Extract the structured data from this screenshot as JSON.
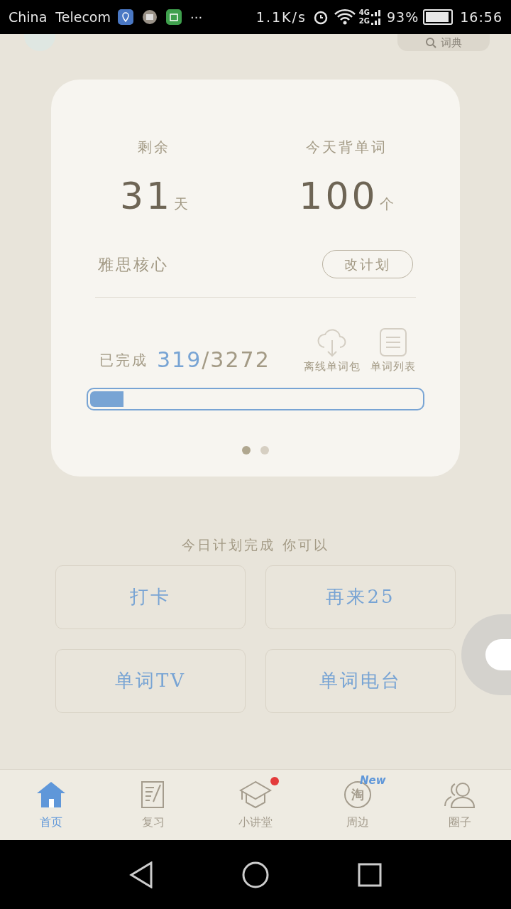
{
  "status_bar": {
    "carrier": "China  Telecom",
    "more": "···",
    "speed": "1.1K/s",
    "net_top": "4G",
    "net_bottom": "2G",
    "battery": "93%",
    "time": "16:56"
  },
  "header": {
    "search_label": "词典"
  },
  "plan_card": {
    "remaining_label": "剩余",
    "remaining_value": "31",
    "remaining_unit": "天",
    "today_label": "今天背单词",
    "today_value": "100",
    "today_unit": "个",
    "book": "雅思核心",
    "change_button": "改计划",
    "done_label": "已完成",
    "done_count": "319",
    "total": "/3272",
    "actions": [
      {
        "kind": "cloud",
        "label": "离线单词包"
      },
      {
        "kind": "list",
        "label": "单词列表"
      }
    ],
    "progress": {
      "level": 0.1
    },
    "pages": [
      {
        "selected": true
      },
      {
        "selected": false
      }
    ]
  },
  "after_plan": {
    "title": "今日计划完成 你可以",
    "buttons": [
      "打卡",
      "再来25",
      "单词TV",
      "单词电台"
    ]
  },
  "tabs": [
    {
      "kind": "home",
      "label": "首页",
      "selected": true
    },
    {
      "kind": "review",
      "label": "复习",
      "selected": false
    },
    {
      "kind": "class",
      "label": "小讲堂",
      "selected": false,
      "dot": true
    },
    {
      "kind": "nearby",
      "label": "周边",
      "selected": false,
      "glyph": "淘",
      "badge": "New"
    },
    {
      "kind": "circle",
      "label": "圈子",
      "selected": false
    }
  ]
}
